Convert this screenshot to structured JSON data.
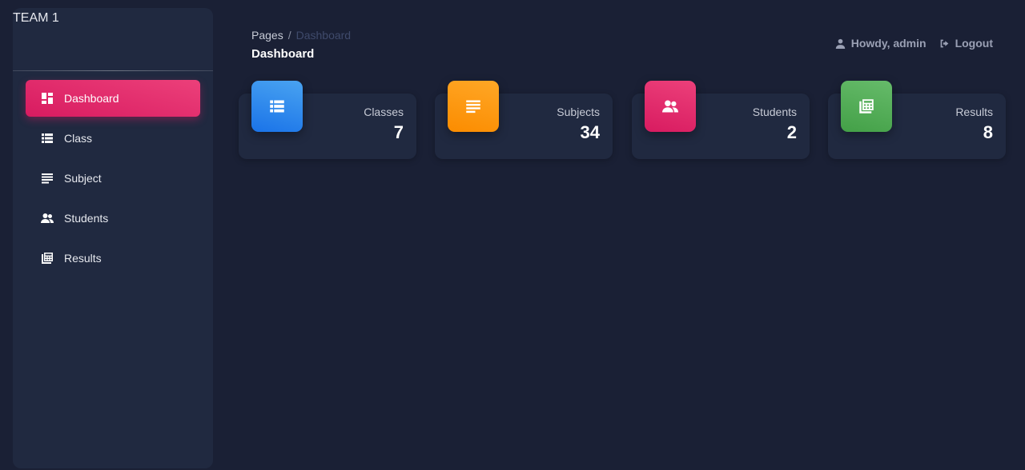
{
  "sidebar": {
    "brand": "TEAM 1",
    "items": [
      {
        "label": "Dashboard",
        "icon": "dashboard-icon",
        "active": true
      },
      {
        "label": "Class",
        "icon": "list-icon"
      },
      {
        "label": "Subject",
        "icon": "lines-icon"
      },
      {
        "label": "Students",
        "icon": "users-icon"
      },
      {
        "label": "Results",
        "icon": "calculator-icon"
      }
    ]
  },
  "header": {
    "breadcrumb": {
      "root": "Pages",
      "separator": "/",
      "current": "Dashboard"
    },
    "title": "Dashboard",
    "greeting": "Howdy, admin",
    "logout": "Logout"
  },
  "cards": [
    {
      "label": "Classes",
      "value": "7",
      "icon": "list-icon",
      "color": "#1e88e5"
    },
    {
      "label": "Subjects",
      "value": "34",
      "icon": "lines-icon",
      "color": "#fb8c00"
    },
    {
      "label": "Students",
      "value": "2",
      "icon": "users-icon",
      "color": "#e91e63"
    },
    {
      "label": "Results",
      "value": "8",
      "icon": "calculator-icon",
      "color": "#43a047"
    }
  ],
  "colors": {
    "background": "#1a2035",
    "panel": "#202940",
    "accent": "#e91e63"
  }
}
